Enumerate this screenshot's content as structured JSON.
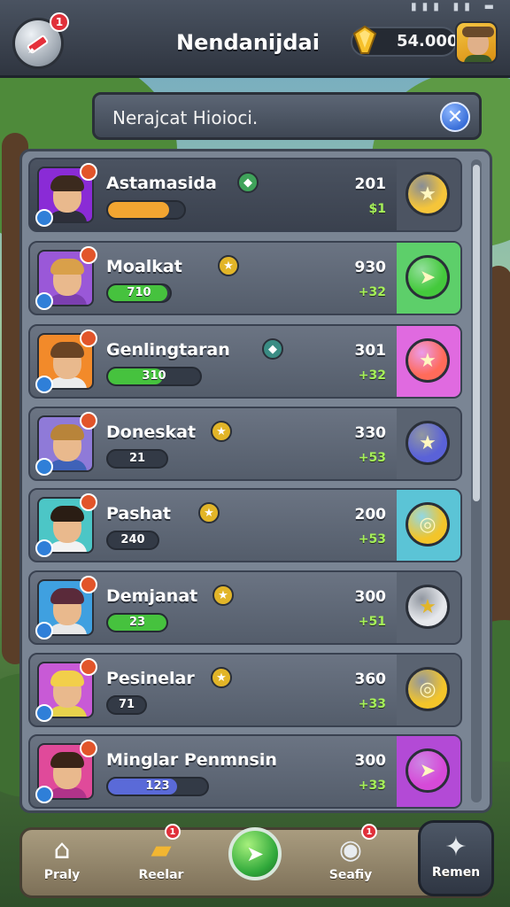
{
  "header": {
    "title": "Nendanijdai",
    "currency_value": "54.000",
    "menu_badge": "1",
    "status": "▮▮▮ ▮▮ ▬"
  },
  "search": {
    "text": "Nerajcat Hioioci.",
    "close_symbol": "✕"
  },
  "players": [
    {
      "name": "Astamasida",
      "score": "201",
      "delta": "$1",
      "bar_label": "",
      "bar_fraction": 0.8,
      "bar_color": "#f2a531",
      "rank_symbol": "◆",
      "rank_color": "#3fa35a",
      "avatar_bg": "#8a2bd6",
      "hair": "#3b2a1e",
      "shirt": "#2d2f3a",
      "action_symbol": "★",
      "action_color": "#f5c53a",
      "slot_color": "#4c5462",
      "action_style": "star"
    },
    {
      "name": "Moalkat",
      "score": "930",
      "delta": "+32",
      "bar_label": "710",
      "bar_fraction": 0.95,
      "bar_color": "#46c23e",
      "rank_symbol": "★",
      "rank_color": "#e2b528",
      "avatar_bg": "#9a58d8",
      "hair": "#d9a04a",
      "shirt": "#7b3fb0",
      "action_symbol": "➤",
      "action_color": "#44c93c",
      "slot_color": "#5dcf6a"
    },
    {
      "name": "Genlingtaran",
      "score": "301",
      "delta": "+32",
      "bar_label": "310",
      "bar_fraction": 0.6,
      "bar_color": "#46c23e",
      "rank_symbol": "◆",
      "rank_color": "#3a8c84",
      "avatar_bg": "#f28a2a",
      "hair": "#6a4424",
      "shirt": "#ececec",
      "action_symbol": "★",
      "action_color": "#ff6b5a",
      "slot_color": "#e06ae0"
    },
    {
      "name": "Doneskat",
      "score": "330",
      "delta": "+53",
      "bar_label": "21",
      "bar_fraction": 0.0,
      "bar_color": "#46c23e",
      "rank_symbol": "★",
      "rank_color": "#e2b528",
      "avatar_bg": "#8f7ad8",
      "hair": "#b8843a",
      "shirt": "#3f62b8",
      "action_symbol": "★",
      "action_color": "#5a62d8",
      "slot_color": "#5a6371"
    },
    {
      "name": "Pashat",
      "score": "200",
      "delta": "+53",
      "bar_label": "240",
      "bar_fraction": 0.0,
      "bar_color": "#46c23e",
      "rank_symbol": "★",
      "rank_color": "#e2b528",
      "avatar_bg": "#4cc6c6",
      "hair": "#2a1d14",
      "shirt": "#f2f2f2",
      "action_symbol": "◎",
      "action_color": "#f3c52a",
      "slot_color": "#5bc4d6"
    },
    {
      "name": "Demjanat",
      "score": "300",
      "delta": "+51",
      "bar_label": "23",
      "bar_fraction": 1.0,
      "bar_color": "#46c23e",
      "rank_symbol": "★",
      "rank_color": "#e2b528",
      "avatar_bg": "#3fa0e0",
      "hair": "#5a2a3a",
      "shirt": "#e8e8e8",
      "action_symbol": "★",
      "action_color": "#e6e8ec",
      "slot_color": "#5a6371"
    },
    {
      "name": "Pesinelar",
      "score": "360",
      "delta": "+33",
      "bar_label": "71",
      "bar_fraction": 0.0,
      "bar_color": "#46c23e",
      "rank_symbol": "★",
      "rank_color": "#e2b528",
      "avatar_bg": "#c85ad6",
      "hair": "#f2cf4a",
      "shirt": "#e7d24c",
      "action_symbol": "◎",
      "action_color": "#f3c52a",
      "slot_color": "#5a6371"
    },
    {
      "name": "Minglar Penmnsin",
      "score": "300",
      "delta": "+33",
      "bar_label": "123",
      "bar_fraction": 0.7,
      "bar_color": "#5a6ad8",
      "rank_symbol": "",
      "rank_color": "#000000",
      "avatar_bg": "#e04a9a",
      "hair": "#3a2418",
      "shirt": "#b0338a",
      "action_symbol": "➤",
      "action_color": "#d64ad8",
      "slot_color": "#b34ad6"
    }
  ],
  "nav": {
    "play_label": "Praly",
    "rewards_label": "Reelar",
    "safety_label": "Seafiy",
    "remen_label": "Remen",
    "rewards_badge": "1",
    "safety_badge": "1"
  }
}
